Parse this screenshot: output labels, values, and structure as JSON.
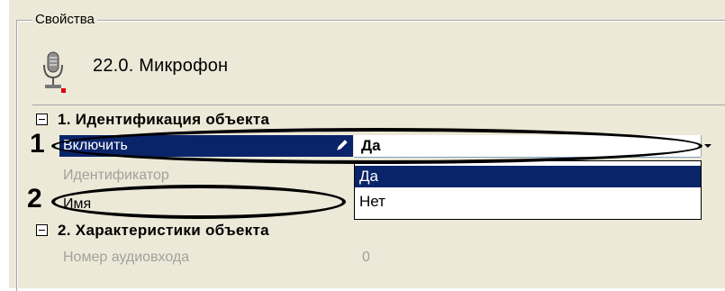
{
  "panel": {
    "group_title": "Свойства",
    "object_name": "22.0. Микрофон",
    "object_icon": "microphone-icon",
    "status_color": "#e00000"
  },
  "grid": {
    "sections": [
      {
        "label": "1. Идентификация объекта",
        "rows": [
          {
            "name": "Включить",
            "value": "Да",
            "state": "editing"
          },
          {
            "name": "Идентификатор",
            "value": "",
            "state": "disabled"
          },
          {
            "name": "Имя",
            "value": "",
            "state": "normal"
          }
        ]
      },
      {
        "label": "2. Характеристики объекта",
        "rows": [
          {
            "name": "Номер аудиовхода",
            "value": "0",
            "state": "disabled"
          }
        ]
      }
    ]
  },
  "dropdown": {
    "options": [
      "Да",
      "Нет"
    ],
    "highlighted": "Да"
  },
  "callouts": [
    "1",
    "2"
  ],
  "colors": {
    "panel_bg": "#ece9d8",
    "selection": "#0a246a",
    "disabled_text": "#a2a19c"
  }
}
